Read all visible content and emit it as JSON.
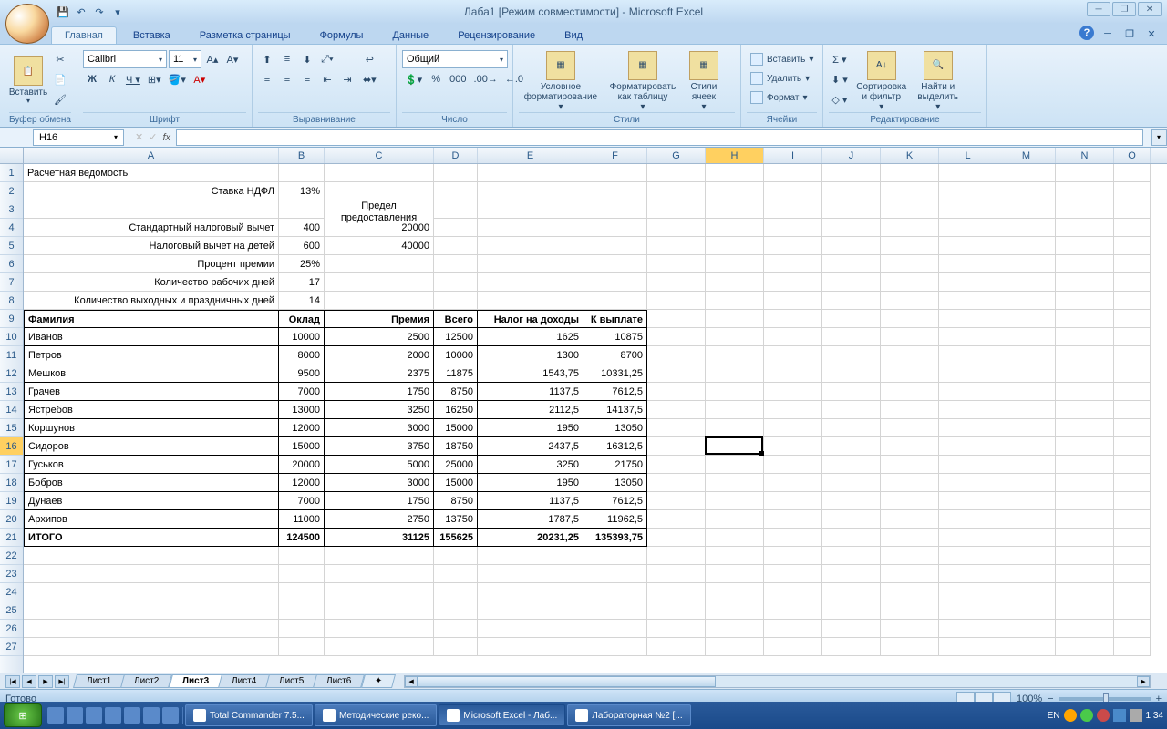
{
  "title": "Лаба1  [Режим совместимости] - Microsoft Excel",
  "tabs": {
    "home": "Главная",
    "insert": "Вставка",
    "layout": "Разметка страницы",
    "formulas": "Формулы",
    "data": "Данные",
    "review": "Рецензирование",
    "view": "Вид"
  },
  "groups": {
    "clipboard": "Буфер обмена",
    "font": "Шрифт",
    "alignment": "Выравнивание",
    "number": "Число",
    "styles": "Стили",
    "cells": "Ячейки",
    "editing": "Редактирование"
  },
  "ribbon": {
    "paste": "Вставить",
    "fontName": "Calibri",
    "fontSize": "11",
    "numberFormat": "Общий",
    "condFormat": "Условное форматирование",
    "formatTable": "Форматировать как таблицу",
    "cellStyles": "Стили ячеек",
    "insert": "Вставить",
    "delete": "Удалить",
    "format": "Формат",
    "sort": "Сортировка и фильтр",
    "find": "Найти и выделить"
  },
  "nameBox": "H16",
  "formula": "",
  "statusReady": "Готово",
  "zoom": "100%",
  "sheets": [
    "Лист1",
    "Лист2",
    "Лист3",
    "Лист4",
    "Лист5",
    "Лист6"
  ],
  "activeSheet": 2,
  "activeCell": {
    "col": "H",
    "row": 16
  },
  "cols": [
    "A",
    "B",
    "C",
    "D",
    "E",
    "F",
    "G",
    "H",
    "I",
    "J",
    "K",
    "L",
    "M",
    "N",
    "O"
  ],
  "colWidths": {
    "A": 280,
    "B": 50,
    "C": 120,
    "D": 48,
    "E": 116,
    "F": 70,
    "G": 64,
    "H": 64,
    "I": 64,
    "J": 64,
    "K": 64,
    "L": 64,
    "M": 64,
    "N": 64,
    "O": 40
  },
  "rows": 27,
  "data": {
    "A1": "Расчетная ведомость",
    "A2": "Ставка НДФЛ",
    "B2": "13%",
    "C3": "Предел предоставления",
    "A4": "Стандартный налоговый вычет",
    "B4": "400",
    "C4": "20000",
    "A5": "Налоговый вычет на детей",
    "B5": "600",
    "C5": "40000",
    "A6": "Процент премии",
    "B6": "25%",
    "A7": "Количество рабочих дней",
    "B7": "17",
    "A8": "Количество выходных и праздничных дней",
    "B8": "14",
    "A9": "Фамилия",
    "B9": "Оклад",
    "C9": "Премия",
    "D9": "Всего",
    "E9": "Налог на доходы",
    "F9": "К выплате",
    "A10": "Иванов",
    "B10": "10000",
    "C10": "2500",
    "D10": "12500",
    "E10": "1625",
    "F10": "10875",
    "A11": "Петров",
    "B11": "8000",
    "C11": "2000",
    "D11": "10000",
    "E11": "1300",
    "F11": "8700",
    "A12": "Мешков",
    "B12": "9500",
    "C12": "2375",
    "D12": "11875",
    "E12": "1543,75",
    "F12": "10331,25",
    "A13": "Грачев",
    "B13": "7000",
    "C13": "1750",
    "D13": "8750",
    "E13": "1137,5",
    "F13": "7612,5",
    "A14": "Ястребов",
    "B14": "13000",
    "C14": "3250",
    "D14": "16250",
    "E14": "2112,5",
    "F14": "14137,5",
    "A15": "Коршунов",
    "B15": "12000",
    "C15": "3000",
    "D15": "15000",
    "E15": "1950",
    "F15": "13050",
    "A16": "Сидоров",
    "B16": "15000",
    "C16": "3750",
    "D16": "18750",
    "E16": "2437,5",
    "F16": "16312,5",
    "A17": "Гуськов",
    "B17": "20000",
    "C17": "5000",
    "D17": "25000",
    "E17": "3250",
    "F17": "21750",
    "A18": "Бобров",
    "B18": "12000",
    "C18": "3000",
    "D18": "15000",
    "E18": "1950",
    "F18": "13050",
    "A19": "Дунаев",
    "B19": "7000",
    "C19": "1750",
    "D19": "8750",
    "E19": "1137,5",
    "F19": "7612,5",
    "A20": "Архипов",
    "B20": "11000",
    "C20": "2750",
    "D20": "13750",
    "E20": "1787,5",
    "F20": "11962,5",
    "A21": "ИТОГО",
    "B21": "124500",
    "C21": "31125",
    "D21": "155625",
    "E21": "20231,25",
    "F21": "135393,75"
  },
  "taskbar": {
    "items": [
      "Total Commander 7.5...",
      "Методические реко...",
      "Microsoft Excel - Лаб...",
      "Лабораторная №2 [..."
    ],
    "activeItem": 2,
    "lang": "EN",
    "time": "1:34"
  }
}
